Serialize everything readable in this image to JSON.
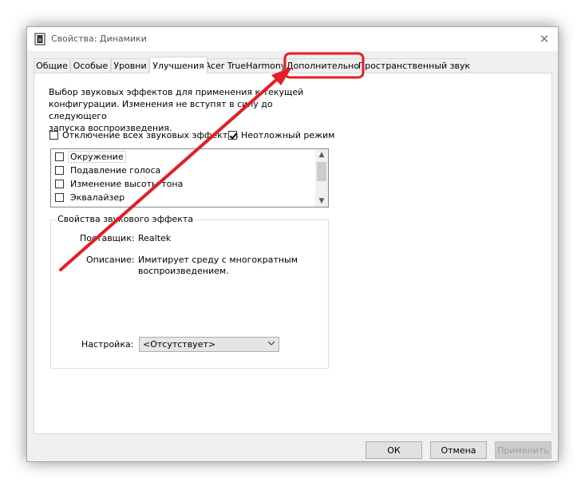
{
  "window": {
    "title": "Свойства: Динамики",
    "close_glyph": "✕"
  },
  "tabs": [
    {
      "label": "Общие",
      "active": false
    },
    {
      "label": "Особые",
      "active": false
    },
    {
      "label": "Уровни",
      "active": false
    },
    {
      "label": "Улучшения",
      "active": true
    },
    {
      "label": "Acer TrueHarmony",
      "active": false
    },
    {
      "label": "Дополнительно",
      "active": false,
      "highlighted": true
    },
    {
      "label": "Пространственный звук",
      "active": false
    }
  ],
  "enhancements": {
    "description_lines": [
      "Выбор звуковых эффектов для применения к текущей",
      "конфигурации. Изменения не вступят в силу до следующего",
      "запуска воспроизведения."
    ],
    "disable_all": {
      "label": "Отключение всех звуковых эффектов",
      "checked": false
    },
    "immediate_mode": {
      "label": "Неотложный режим",
      "checked": true
    },
    "effects": [
      {
        "label": "Окружение",
        "checked": false
      },
      {
        "label": "Подавление голоса",
        "checked": false
      },
      {
        "label": "Изменение высоты тона",
        "checked": false
      },
      {
        "label": "Эквалайзер",
        "checked": false
      }
    ],
    "properties": {
      "group_title": "Свойства звукового эффекта",
      "provider_label": "Поставщик:",
      "provider_value": "Realtek",
      "description_label": "Описание:",
      "description_lines": [
        "Имитирует среду с многократным",
        "воспроизведением."
      ],
      "setting_label": "Настройка:",
      "setting_value": "<Отсутствует>"
    }
  },
  "buttons": {
    "ok": "ОК",
    "cancel": "Отмена",
    "apply": "Применить"
  },
  "colors": {
    "annotation_red": "#e31e24",
    "window_bg": "#f0f0f0"
  },
  "icons": {
    "app": "speaker-properties-icon",
    "close": "close-icon",
    "scroll_up": "scroll-up-arrow-icon",
    "scroll_down": "scroll-down-arrow-icon",
    "combo": "chevron-down-icon"
  }
}
